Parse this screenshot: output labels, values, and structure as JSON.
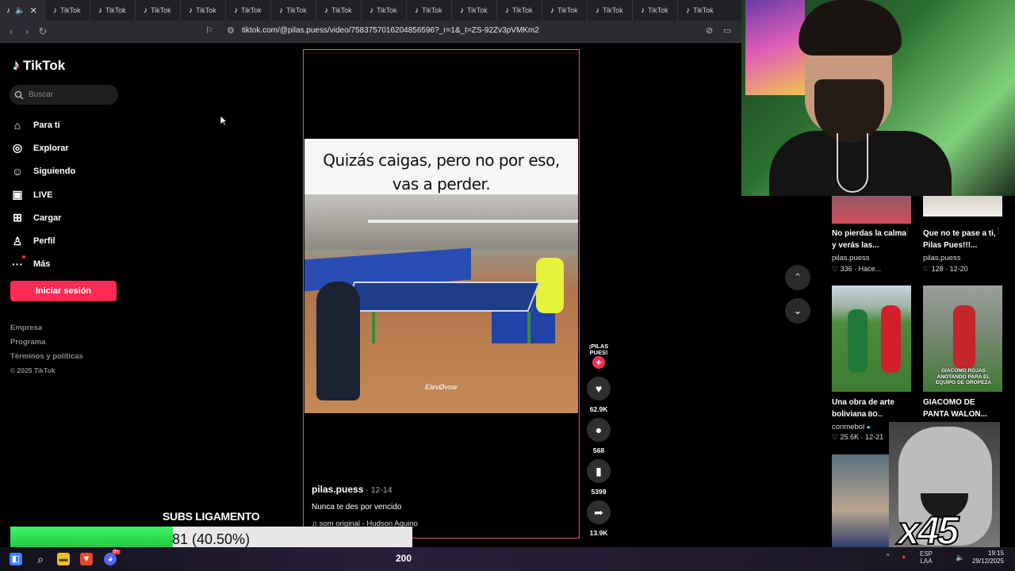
{
  "browser": {
    "tab_label": "TikTok",
    "tab_count": 15,
    "url": "tiktok.com/@pilas.puess/video/7583757016204856596?_r=1&_t=ZS-92Zv3pVMKm2"
  },
  "sidebar": {
    "logo": "TikTok",
    "search_placeholder": "Buscar",
    "items": [
      {
        "label": "Para ti",
        "icon": "home-icon"
      },
      {
        "label": "Explorar",
        "icon": "compass-icon"
      },
      {
        "label": "Siguiendo",
        "icon": "following-icon"
      },
      {
        "label": "LIVE",
        "icon": "live-icon"
      },
      {
        "label": "Cargar",
        "icon": "upload-icon"
      },
      {
        "label": "Perfil",
        "icon": "profile-icon"
      },
      {
        "label": "Más",
        "icon": "more-icon"
      }
    ],
    "login_button": "Iniciar sesión",
    "footer": [
      "Empresa",
      "Programa",
      "Términos y políticas",
      "© 2025 TikTok"
    ]
  },
  "video": {
    "caption_line1": "Quizás caigas, pero no por eso,",
    "caption_line2": "vas a perder.",
    "watermark": "ElevØvow",
    "author": "pilas.puess",
    "date": " · 12-14",
    "description": "Nunca te des por vencido",
    "sound": "♫ som original - Hudson Aquino"
  },
  "actions": {
    "avatar_text": "¡PILAS PUES!",
    "likes": "62.9K",
    "comments": "568",
    "saves": "5399",
    "shares": "13.9K"
  },
  "related": [
    {
      "title": "No pierdas la calma y verás las...",
      "author": "pilas.puess",
      "likes": "336",
      "time": "Hace..."
    },
    {
      "title": "Que no te pase a ti, Pilas Pues!!!...",
      "author": "pilas.puess",
      "likes": "128",
      "time": "12-20"
    },
    {
      "title": "Una obra de arte boliviana",
      "title_suffix": " BO...",
      "author": "conmebol",
      "likes": "25.6K",
      "time": "12-21"
    },
    {
      "title": "GIACOMO DE PANTA WALON...",
      "thumb_text": "GIACOMO ROJAS ANOTANDO PARA EL EQUIPO DE OROPEZA",
      "author": "",
      "likes": "",
      "time": ""
    }
  ],
  "overlays": {
    "goal_title": "SUBS LIGAMENTO",
    "goal_text": "81 (40.50%)",
    "goal_progress": 0.405,
    "meme_text": "x45"
  },
  "taskbar": {
    "center_text": "200",
    "lang_line1": "ESP",
    "lang_line2": "LAA",
    "time": "19:15",
    "date": "29/12/2025",
    "discord_badge": "9+"
  },
  "colors": {
    "brand": "#fe2c55",
    "accent_cyan": "#25f4ee",
    "goal_green": "#27d84b"
  }
}
